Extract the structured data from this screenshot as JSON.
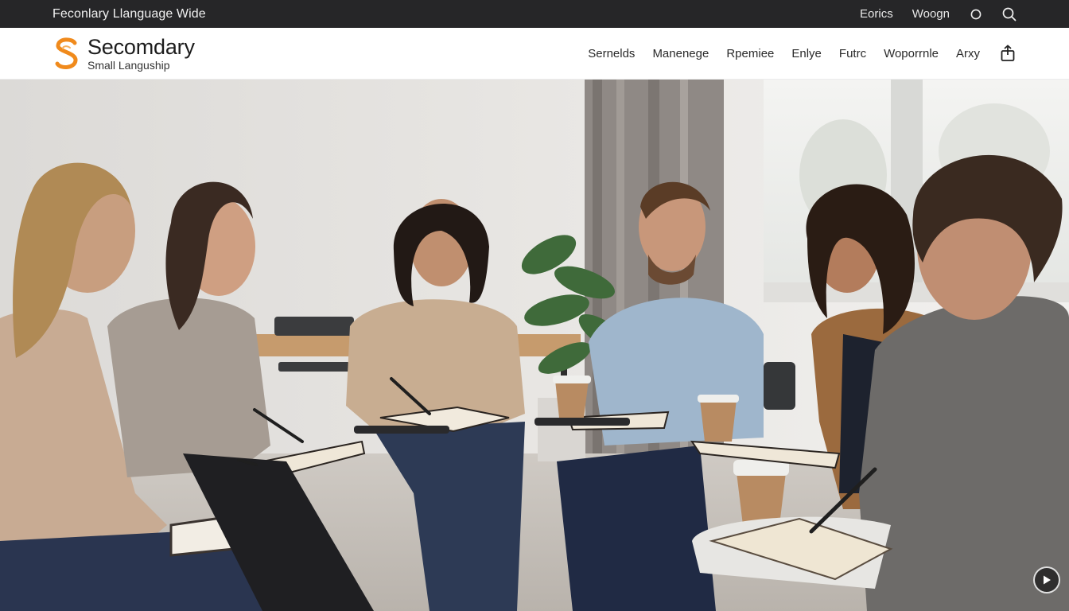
{
  "topbar": {
    "site_name": "Feconlary Llanguage Wide",
    "links": [
      "Eorics",
      "Woogn"
    ],
    "icons": [
      "circle-icon",
      "search-icon"
    ]
  },
  "brand": {
    "title": "Secomdary",
    "subtitle": "Small Languship",
    "accent": "#f08a1c"
  },
  "nav": {
    "items": [
      "Sernelds",
      "Manenege",
      "Rpemiee",
      "Enlye",
      "Futrc",
      "Woporrnle",
      "Arxy"
    ],
    "share_icon": "share-icon"
  },
  "hero": {
    "description_icon": "play-icon"
  }
}
